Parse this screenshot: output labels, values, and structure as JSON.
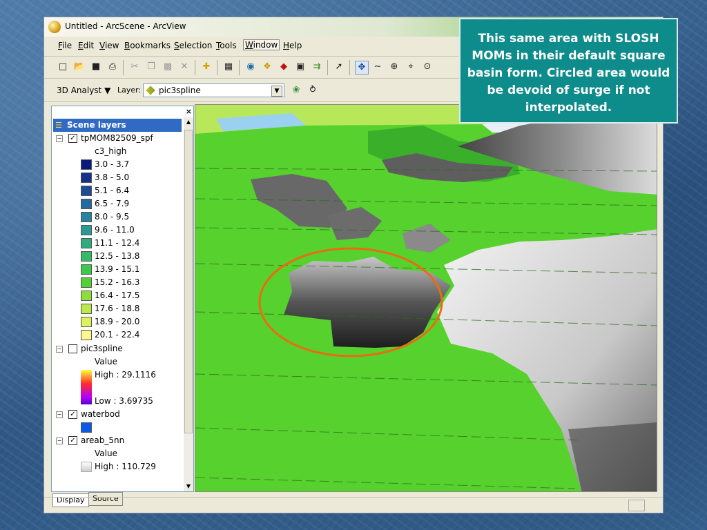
{
  "window": {
    "title": "Untitled - ArcScene - ArcView"
  },
  "menu": [
    "File",
    "Edit",
    "View",
    "Bookmarks",
    "Selection",
    "Tools",
    "Window",
    "Help"
  ],
  "toolbar2": {
    "analyst": "3D Analyst ▼",
    "layer_label": "Layer:",
    "layer_value": "pic3spline"
  },
  "toc": {
    "title": "Scene layers",
    "layers": [
      {
        "name": "tpMOM82509_spf",
        "checked": true,
        "field": "c3_high",
        "classes": [
          {
            "label": "3.0 - 3.7",
            "color": "#0a1a7a"
          },
          {
            "label": "3.8 - 5.0",
            "color": "#15318c"
          },
          {
            "label": "5.1 - 6.4",
            "color": "#1e4a96"
          },
          {
            "label": "6.5 - 7.9",
            "color": "#236a9e"
          },
          {
            "label": "8.0 - 9.5",
            "color": "#27839e"
          },
          {
            "label": "9.6 - 11.0",
            "color": "#2c9a94"
          },
          {
            "label": "11.1 - 12.4",
            "color": "#30ab80"
          },
          {
            "label": "12.5 - 13.8",
            "color": "#34bb66"
          },
          {
            "label": "13.9 - 15.1",
            "color": "#3ac94a"
          },
          {
            "label": "15.2 - 16.3",
            "color": "#52d234"
          },
          {
            "label": "16.4 - 17.5",
            "color": "#8ede3a"
          },
          {
            "label": "17.6 - 18.8",
            "color": "#bce84a"
          },
          {
            "label": "18.9 - 20.0",
            "color": "#e0f25a"
          },
          {
            "label": "20.1 - 22.4",
            "color": "#fff88c"
          }
        ]
      },
      {
        "name": "pic3spline",
        "checked": false,
        "value_label": "Value",
        "high": "High : 29.1116",
        "low": "Low : 3.69735"
      },
      {
        "name": "waterbod",
        "checked": true,
        "color": "#0a5ae8"
      },
      {
        "name": "areab_5nn",
        "checked": true,
        "value_label": "Value",
        "high": "High : 110.729"
      }
    ]
  },
  "tabs": [
    "Display",
    "Source"
  ],
  "callout": "This same area with SLOSH MOMs in their default square basin form.  Circled area would be devoid of surge if not interpolated.",
  "colors": {
    "callout_bg": "#0e8b8b",
    "terrain_green": "#56d12e",
    "circle": "#ec6a10"
  }
}
